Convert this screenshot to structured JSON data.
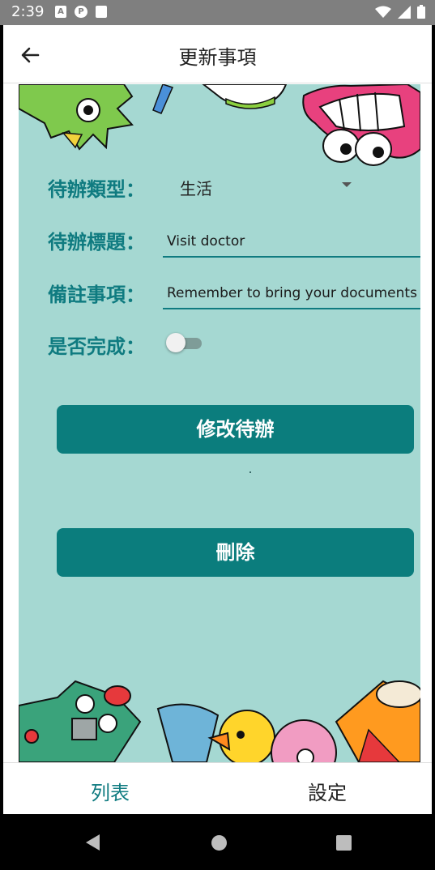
{
  "status_bar": {
    "time": "2:39",
    "left_icons": [
      "a-icon",
      "p-icon",
      "sd-card-icon"
    ],
    "right_icons": [
      "wifi-icon",
      "signal-icon",
      "battery-icon"
    ]
  },
  "app_bar": {
    "back_icon": "arrow-back-icon",
    "title": "更新事項"
  },
  "form": {
    "type_label": "待辦類型：",
    "type_value": "生活",
    "title_label": "待辦標題：",
    "title_value": "Visit doctor",
    "note_label": "備註事項：",
    "note_value": "Remember to bring your documents",
    "done_label": "是否完成：",
    "done_checked": false
  },
  "buttons": {
    "update_label": "修改待辦",
    "delete_label": "刪除"
  },
  "bottom_nav": {
    "items": [
      {
        "label": "列表",
        "active": true
      },
      {
        "label": "設定",
        "active": false
      }
    ]
  },
  "colors": {
    "accent": "#0f7b80",
    "button": "#0b7d7d",
    "panel_bg": "#a5d8d2"
  }
}
